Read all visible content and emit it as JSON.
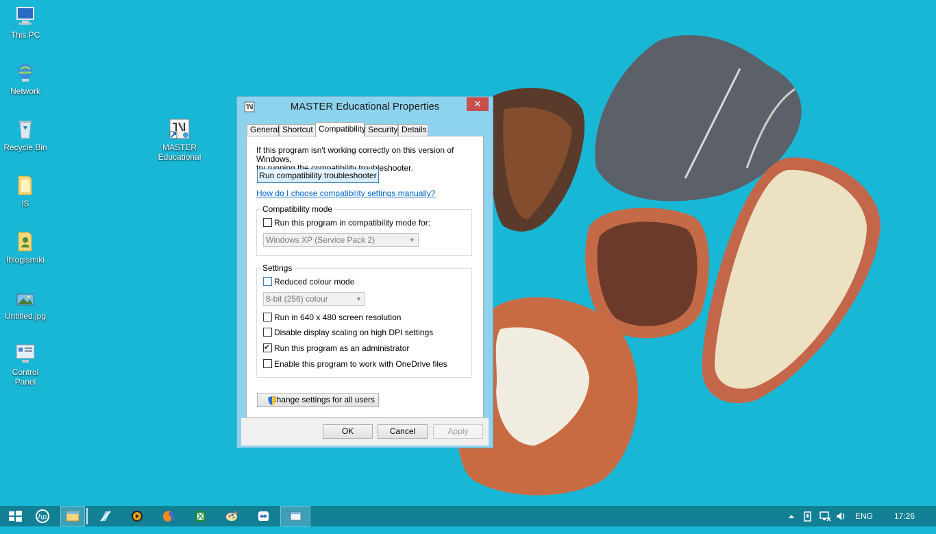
{
  "desktop": {
    "icons": [
      {
        "label": "This PC",
        "icon": "computer-icon"
      },
      {
        "label": "Network",
        "icon": "network-icon"
      },
      {
        "label": "Recycle Bin",
        "icon": "recycle-bin-icon"
      },
      {
        "label": "IS",
        "icon": "folder-icon"
      },
      {
        "label": "Ihlogismiki",
        "icon": "user-folder-icon"
      },
      {
        "label": "Untitled.jpg",
        "icon": "image-file-icon"
      },
      {
        "label": "Control Panel",
        "icon": "control-panel-icon"
      },
      {
        "label": "MASTER Educational",
        "icon": "shortcut-icon"
      }
    ]
  },
  "dialog": {
    "title": "MASTER Educational Properties",
    "close_label": "✕",
    "tabs": [
      "General",
      "Shortcut",
      "Compatibility",
      "Security",
      "Details"
    ],
    "active_tab": "Compatibility",
    "info_line1": "If this program isn't working correctly on this version of Windows,",
    "info_line2": "try running the compatibility troubleshooter.",
    "troubleshooter_button": "Run compatibility troubleshooter",
    "manual_link": "How do I choose compatibility settings manually?",
    "compat_mode": {
      "label": "Compatibility mode",
      "checkbox_label": "Run this program in compatibility mode for:",
      "checked": false,
      "os_value": "Windows XP (Service Pack 2)"
    },
    "settings": {
      "label": "Settings",
      "reduced_colour": {
        "label": "Reduced colour mode",
        "checked": false
      },
      "colour_value": "8-bit (256) colour",
      "res_640": {
        "label": "Run in 640 x 480 screen resolution",
        "checked": false
      },
      "dpi": {
        "label": "Disable display scaling on high DPI settings",
        "checked": false
      },
      "admin": {
        "label": "Run this program as an administrator",
        "checked": true
      },
      "onedrive": {
        "label": "Enable this program to work with OneDrive files",
        "checked": false
      }
    },
    "change_all_button": "Change settings for all users",
    "ok": "OK",
    "cancel": "Cancel",
    "apply": "Apply"
  },
  "taskbar": {
    "items": [
      "start-icon",
      "hp-icon",
      "file-explorer-icon",
      "app-icon",
      "media-player-icon",
      "firefox-icon",
      "excel-icon",
      "paint-icon",
      "teamviewer-icon",
      "window-icon"
    ],
    "language": "ENG",
    "time": "17:26"
  },
  "colors": {
    "desktop_bg": "#19b7d6",
    "taskbar_bg": "#127f95",
    "dialog_frame": "#8ed3ee",
    "close_button": "#c7504c",
    "link": "#0066cc"
  }
}
